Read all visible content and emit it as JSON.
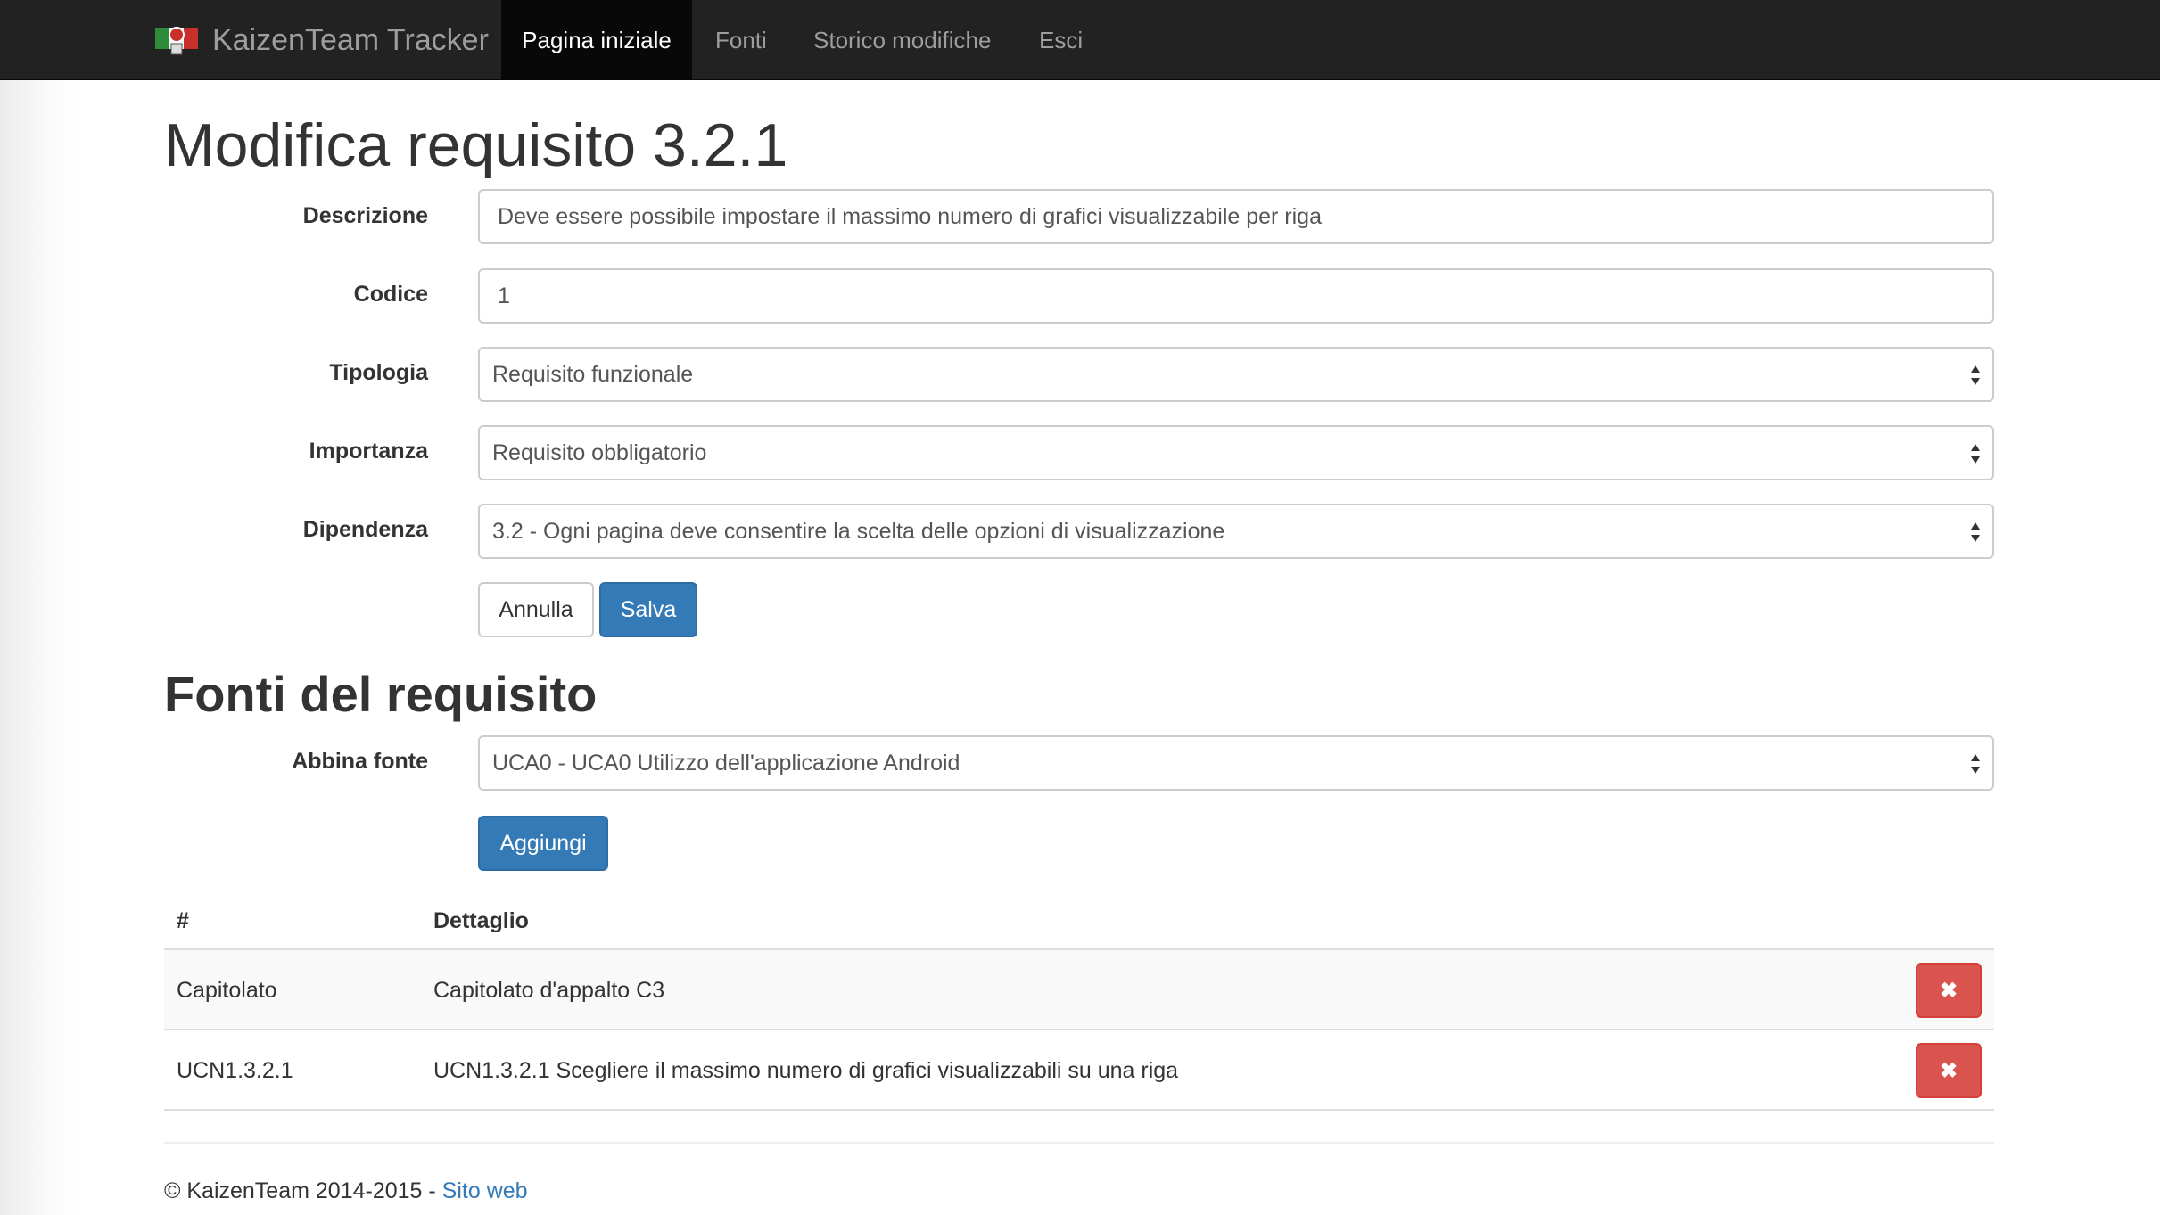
{
  "navbar": {
    "brand": "KaizenTeam Tracker",
    "items": [
      {
        "label": "Pagina iniziale",
        "active": true
      },
      {
        "label": "Fonti",
        "active": false
      },
      {
        "label": "Storico modifiche",
        "active": false
      },
      {
        "label": "Esci",
        "active": false
      }
    ]
  },
  "page": {
    "title": "Modifica requisito 3.2.1"
  },
  "form": {
    "descrizione": {
      "label": "Descrizione",
      "value": "Deve essere possibile impostare il massimo numero di grafici visualizzabile per riga"
    },
    "codice": {
      "label": "Codice",
      "value": "1"
    },
    "tipologia": {
      "label": "Tipologia",
      "value": "Requisito funzionale"
    },
    "importanza": {
      "label": "Importanza",
      "value": "Requisito obbligatorio"
    },
    "dipendenza": {
      "label": "Dipendenza",
      "value": "3.2 - Ogni pagina deve consentire la scelta delle opzioni di visualizzazione"
    },
    "cancel_label": "Annulla",
    "save_label": "Salva"
  },
  "fonti": {
    "title": "Fonti del requisito",
    "abbina_label": "Abbina fonte",
    "abbina_value": "UCA0 - UCA0 Utilizzo dell'applicazione Android",
    "add_label": "Aggiungi",
    "table": {
      "headers": [
        "#",
        "Dettaglio"
      ],
      "rows": [
        {
          "id": "Capitolato",
          "detail": "Capitolato d'appalto C3",
          "delete_label": "✖"
        },
        {
          "id": "UCN1.3.2.1",
          "detail": "UCN1.3.2.1 Scegliere il massimo numero di grafici visualizzabili su una riga",
          "delete_label": "✖"
        }
      ]
    }
  },
  "footer": {
    "text": "© KaizenTeam 2014-2015 - ",
    "link": "Sito web"
  },
  "colors": {
    "navbar_bg": "#222222",
    "primary": "#337ab7",
    "danger": "#d9534f"
  }
}
